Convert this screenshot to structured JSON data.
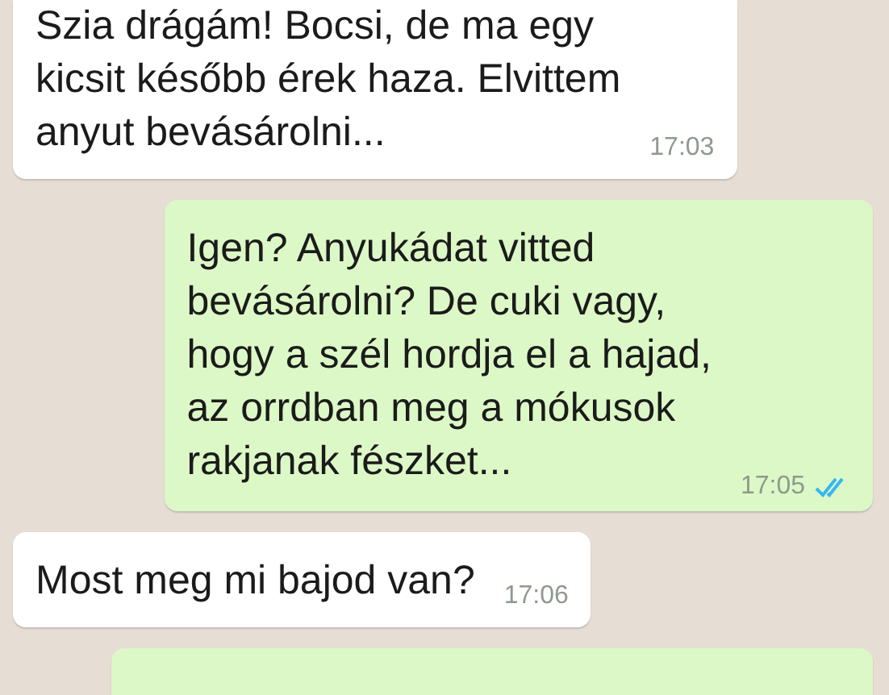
{
  "messages": [
    {
      "kind": "incoming",
      "lines": [
        "Szia drágám! Bocsi, de ma egy",
        "kicsit később érek haza. Elvittem",
        "anyut bevásárolni..."
      ],
      "time": "17:03"
    },
    {
      "kind": "outgoing",
      "lines": [
        "Igen? Anyukádat vitted",
        "bevásárolni? De cuki vagy,",
        "hogy a szél hordja el a hajad,",
        "az orrdban meg a mókusok",
        "rakjanak fészket..."
      ],
      "time": "17:05",
      "read": true
    },
    {
      "kind": "incoming",
      "lines": [
        "Most meg mi bajod van?"
      ],
      "time": "17:06"
    },
    {
      "kind": "outgoing"
    }
  ]
}
